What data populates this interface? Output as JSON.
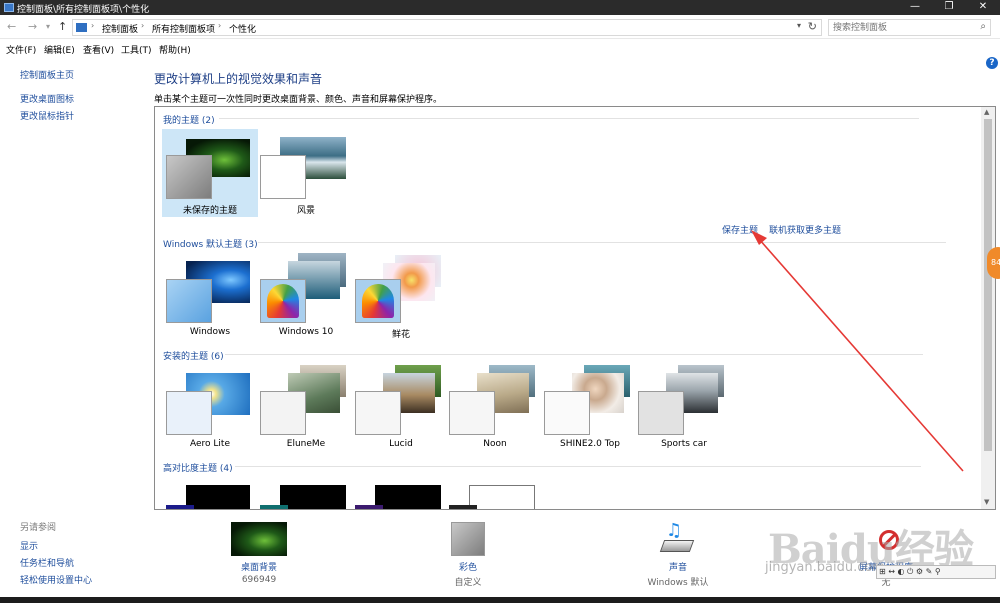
{
  "window": {
    "title": "控制面板\\所有控制面板项\\个性化",
    "buttons": {
      "minimize": "—",
      "restore": "❐",
      "close": "✕"
    }
  },
  "address": {
    "crumbs": [
      "控制面板",
      "所有控制面板项",
      "个性化"
    ],
    "search_placeholder": "搜索控制面板"
  },
  "menubar": [
    "文件(F)",
    "编辑(E)",
    "查看(V)",
    "工具(T)",
    "帮助(H)"
  ],
  "sidebar": {
    "home": "控制面板主页",
    "links": [
      "更改桌面图标",
      "更改鼠标指针"
    ],
    "see_also_title": "另请参阅",
    "see_also": [
      "显示",
      "任务栏和导航",
      "轻松使用设置中心"
    ]
  },
  "main": {
    "heading": "更改计算机上的视觉效果和声音",
    "subheading": "单击某个主题可一次性同时更改桌面背景、颜色、声音和屏幕保护程序。",
    "save_theme": "保存主题",
    "get_more": "联机获取更多主题",
    "groups": [
      {
        "title": "我的主题 (2)",
        "themes": [
          "未保存的主题",
          "风景"
        ]
      },
      {
        "title": "Windows 默认主题 (3)",
        "themes": [
          "Windows",
          "Windows 10",
          "鲜花"
        ]
      },
      {
        "title": "安装的主题 (6)",
        "themes": [
          "Aero Lite",
          "EluneMe",
          "Lucid",
          "Noon",
          "SHINE2.0 Top",
          "Sports car"
        ]
      },
      {
        "title": "高对比度主题 (4)",
        "themes": []
      }
    ]
  },
  "bottom": [
    {
      "label": "桌面背景",
      "sub": "696949"
    },
    {
      "label": "彩色",
      "sub": "自定义"
    },
    {
      "label": "声音",
      "sub": "Windows 默认"
    },
    {
      "label": "屏幕保护程序",
      "sub": "无"
    }
  ],
  "watermark": {
    "brand": "Baidu经验",
    "url": "jingyan.baidu.com"
  },
  "colors": {
    "link": "#1f4e9c",
    "heading": "#1e3f86",
    "selection": "#cde6f7",
    "arrow": "#e53935"
  },
  "icons": [
    "back-arrow-icon",
    "forward-arrow-icon",
    "up-arrow-icon",
    "control-panel-icon",
    "refresh-icon",
    "search-icon",
    "help-icon",
    "sound-icon",
    "screensaver-icon"
  ]
}
